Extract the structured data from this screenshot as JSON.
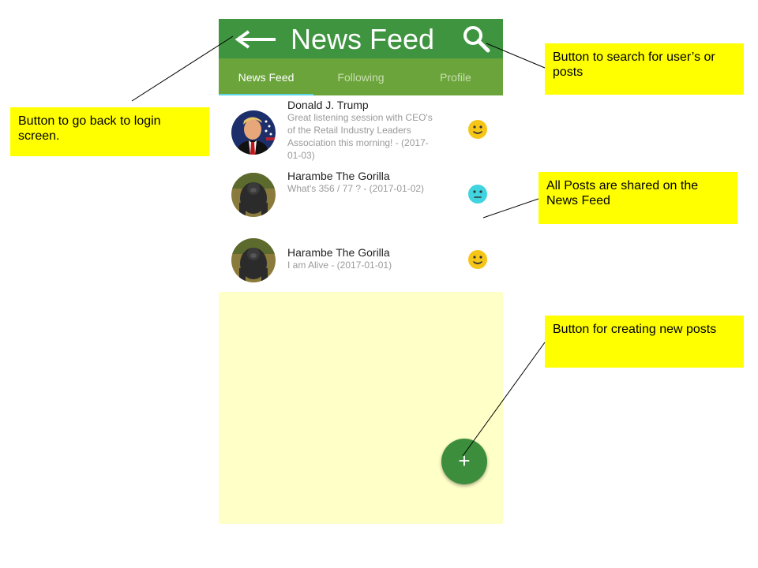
{
  "app": {
    "title": "News Feed",
    "back_icon": "left-arrow-icon",
    "search_icon": "search-icon"
  },
  "tabs": [
    {
      "label": "News Feed",
      "active": true
    },
    {
      "label": "Following",
      "active": false
    },
    {
      "label": "Profile",
      "active": false
    }
  ],
  "posts": [
    {
      "author": "Donald J. Trump",
      "text": "Great listening session with CEO's of the Retail Industry Leaders Association this morning! - (2017-01-03)",
      "mood_icon": "smiley-icon",
      "mood_color": "#f5c518"
    },
    {
      "author": "Harambe The Gorilla",
      "text": "What's 356 / 77 ? - (2017-01-02)",
      "mood_icon": "neutral-face-icon",
      "mood_color": "#3fd4e0"
    },
    {
      "author": "Harambe The Gorilla",
      "text": "I am Alive - (2017-01-01)",
      "mood_icon": "smiley-icon",
      "mood_color": "#f5c518"
    }
  ],
  "fab": {
    "label": "+",
    "icon": "plus-icon"
  },
  "annotations": [
    {
      "text": "Button to go back to login screen."
    },
    {
      "text": "Button to search for user’s or posts"
    },
    {
      "text": "All Posts are shared on the News Feed"
    },
    {
      "text": "Button for creating new posts"
    }
  ],
  "colors": {
    "appbar": "#3f9440",
    "tabbar": "#6aa43b",
    "tab_indicator": "#5ad6e6",
    "content_bg": "#ffffc8",
    "fab": "#3c8e3d",
    "callout": "#ffff00"
  }
}
